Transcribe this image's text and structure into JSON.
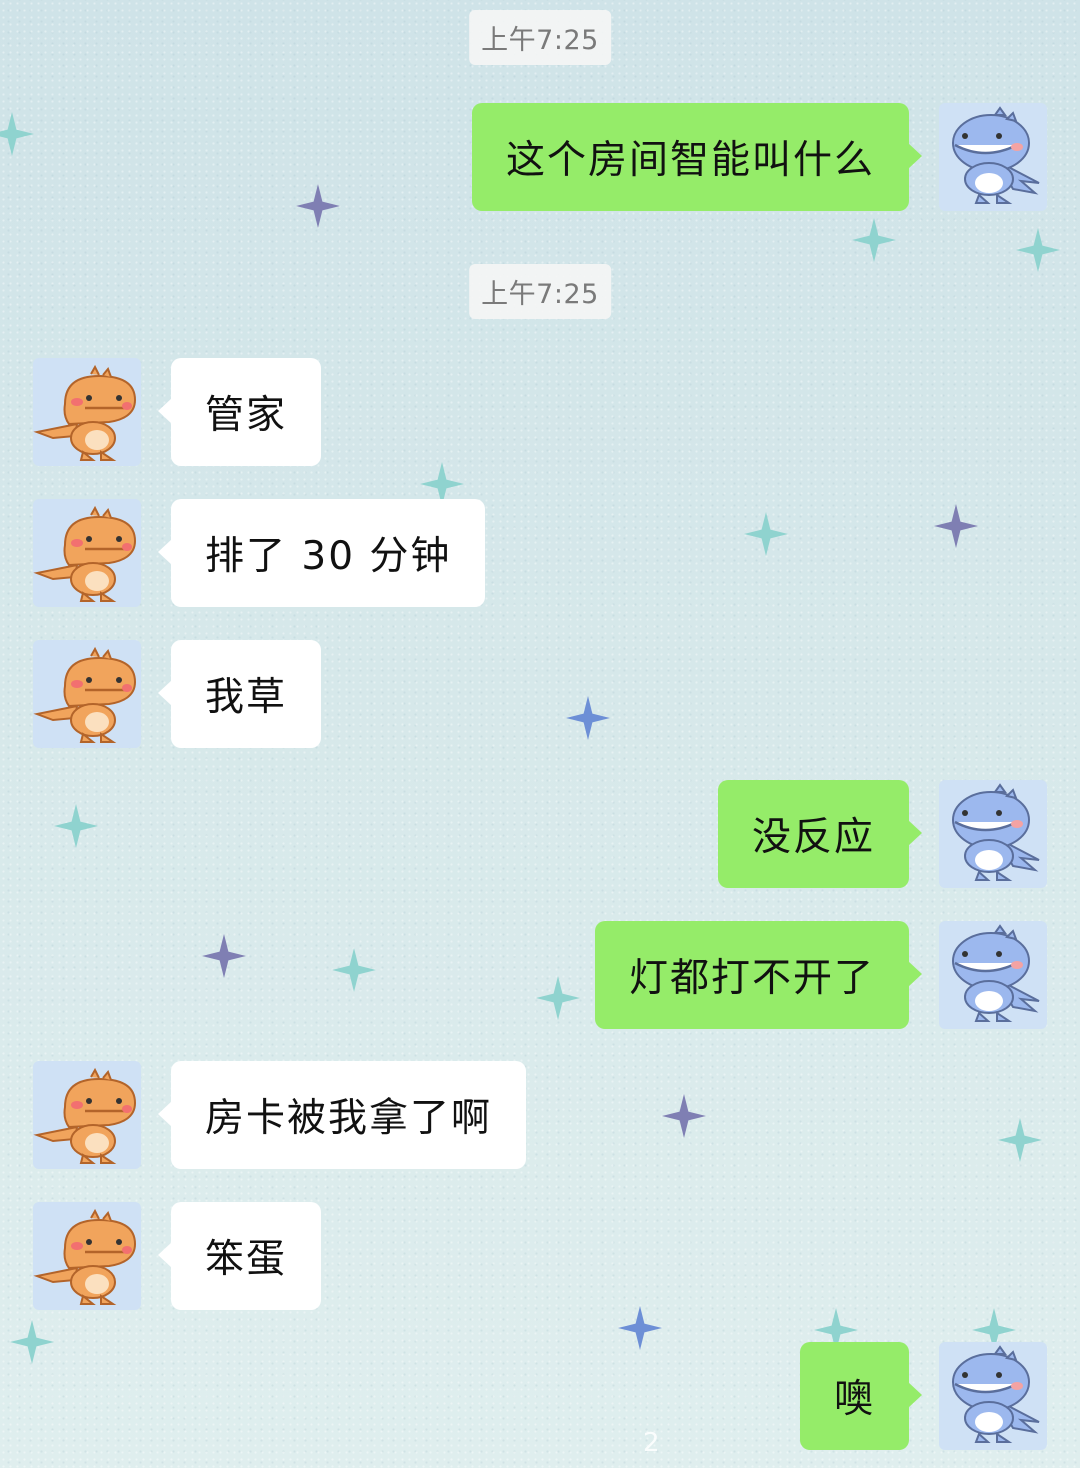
{
  "chat": {
    "timestamps": [
      "上午7:25",
      "上午7:25"
    ],
    "messages": [
      {
        "side": "right",
        "text": "这个房间智能叫什么"
      },
      {
        "side": "left",
        "text": "管家"
      },
      {
        "side": "left",
        "text": "排了 30 分钟"
      },
      {
        "side": "left",
        "text": "我草"
      },
      {
        "side": "right",
        "text": "没反应"
      },
      {
        "side": "right",
        "text": "灯都打不开了"
      },
      {
        "side": "left",
        "text": "房卡被我拿了啊"
      },
      {
        "side": "left",
        "text": "笨蛋"
      },
      {
        "side": "right",
        "text": "噢"
      }
    ]
  },
  "avatars": {
    "left": "orange-dinosaur-avatar",
    "right": "blue-dinosaur-avatar"
  },
  "colors": {
    "sent_bubble": "#95ec69",
    "received_bubble": "#ffffff",
    "background": "#d6e8ea"
  },
  "page_indicator": "2"
}
